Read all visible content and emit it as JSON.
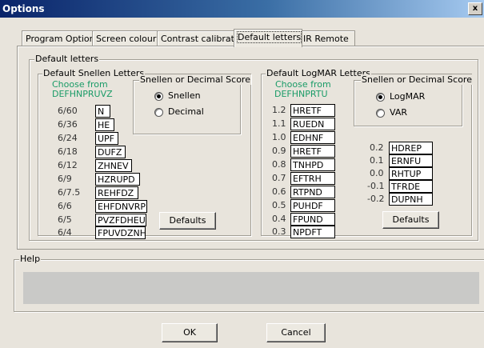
{
  "window": {
    "title": "Options",
    "close_label": "x"
  },
  "tabs": [
    {
      "label": "Program Options"
    },
    {
      "label": "Screen colours"
    },
    {
      "label": "Contrast calibration"
    },
    {
      "label": "Default letters"
    },
    {
      "label": "IR Remote"
    }
  ],
  "active_tab": "Default letters",
  "default_letters": {
    "group_label": "Default letters",
    "snellen": {
      "group_label": "Default Snellen Letters",
      "choose_from_label": "Choose from",
      "choose_from_letters": "DEFHNPRUVZ",
      "rows": [
        {
          "label": "6/60",
          "letters": "N"
        },
        {
          "label": "6/36",
          "letters": "HE"
        },
        {
          "label": "6/24",
          "letters": "UPF"
        },
        {
          "label": "6/18",
          "letters": "DUFZ"
        },
        {
          "label": "6/12",
          "letters": "ZHNEV"
        },
        {
          "label": "6/9",
          "letters": "HZRUPD"
        },
        {
          "label": "6/7.5",
          "letters": "REHFDZ"
        },
        {
          "label": "6/6",
          "letters": "EHFDNVRP"
        },
        {
          "label": "6/5",
          "letters": "PVZFDHEU"
        },
        {
          "label": "6/4",
          "letters": "FPUVDZNH"
        }
      ],
      "score_group_label": "Snellen or Decimal Score",
      "options": [
        {
          "label": "Snellen",
          "selected": true
        },
        {
          "label": "Decimal",
          "selected": false
        }
      ],
      "defaults_button": "Defaults"
    },
    "logmar": {
      "group_label": "Default LogMAR Letters",
      "choose_from_label": "Choose from",
      "choose_from_letters": "DEFHNPRTU",
      "rows": [
        {
          "label": "1.2",
          "letters": "HRETF"
        },
        {
          "label": "1.1",
          "letters": "RUEDN"
        },
        {
          "label": "1.0",
          "letters": "EDHNF"
        },
        {
          "label": "0.9",
          "letters": "HRETF"
        },
        {
          "label": "0.8",
          "letters": "TNHPD"
        },
        {
          "label": "0.7",
          "letters": "EFTRH"
        },
        {
          "label": "0.6",
          "letters": "RTPND"
        },
        {
          "label": "0.5",
          "letters": "PUHDF"
        },
        {
          "label": "0.4",
          "letters": "FPUND"
        },
        {
          "label": "0.3",
          "letters": "NPDFT"
        }
      ],
      "extra_rows": [
        {
          "label": "0.2",
          "letters": "HDREP"
        },
        {
          "label": "0.1",
          "letters": "ERNFU"
        },
        {
          "label": "0.0",
          "letters": "RHTUP"
        },
        {
          "label": "-0.1",
          "letters": "TFRDE"
        },
        {
          "label": "-0.2",
          "letters": "DUPNH"
        }
      ],
      "score_group_label": "Snellen or Decimal Score",
      "options": [
        {
          "label": "LogMAR",
          "selected": true
        },
        {
          "label": "VAR",
          "selected": false
        }
      ],
      "defaults_button": "Defaults"
    }
  },
  "help": {
    "group_label": "Help"
  },
  "footer": {
    "ok_label": "OK",
    "cancel_label": "Cancel"
  },
  "colors": {
    "accent_green": "#1a9b67",
    "titlebar_dark": "#0a246a"
  }
}
